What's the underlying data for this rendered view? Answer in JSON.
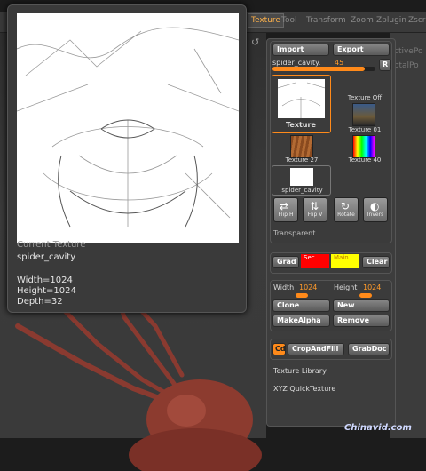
{
  "menubar": {
    "items": [
      "Texture",
      "Tool",
      "Transform",
      "Zoom",
      "Zplugin",
      "Zscr"
    ],
    "active": "Texture"
  },
  "side_labels": [
    "ctivePo",
    "otalPo"
  ],
  "popup": {
    "caption": "Current Texture",
    "name": "spider_cavity",
    "width": "Width=1024",
    "height": "Height=1024",
    "depth": "Depth=32"
  },
  "palette": {
    "import": "Import",
    "export": "Export",
    "texture_name": "spider_cavity.",
    "texture_value": "45",
    "texture_fraction": 0.9,
    "r_button": "R",
    "thumbs": [
      {
        "label": "Texture"
      },
      {
        "label": "Texture  Off"
      },
      {
        "label": "Texture  01"
      },
      {
        "label": "Texture  27"
      },
      {
        "label": "Texture  40"
      },
      {
        "label": "spider_cavity"
      }
    ],
    "tools": [
      "Flip H",
      "Flip V",
      "Rotate",
      "Invers"
    ],
    "transparent": "Transparent",
    "grad": "Grad",
    "sec": "Sec",
    "main": "Main",
    "clear": "Clear",
    "width_label": "Width",
    "width_value": "1024",
    "height_label": "Height",
    "height_value": "1024",
    "clone": "Clone",
    "new": "New",
    "make_alpha": "MakeAlpha",
    "remove": "Remove",
    "cd": "Cd",
    "crop_and_fill": "CropAndFill",
    "grab_doc": "GrabDoc",
    "texture_library": "Texture Library",
    "xyz_quicktexture": "XYZ QuickTexture"
  },
  "colors": {
    "accent": "#ff9a2a",
    "sec_color": "#ff0000",
    "main_color": "#ffff00"
  },
  "watermark": "Chinavid.com"
}
